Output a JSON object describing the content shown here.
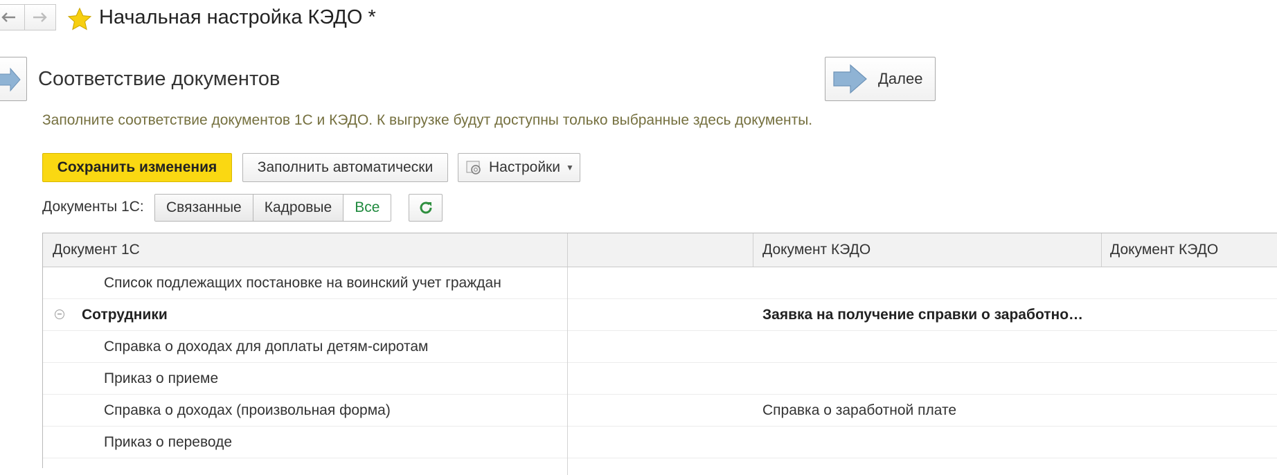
{
  "window": {
    "title": "Начальная настройка КЭДО *",
    "back_icon": "arrow-left-icon",
    "forward_icon": "arrow-right-icon",
    "favorite_icon": "star-icon"
  },
  "header": {
    "title": "Соответствие документов",
    "next_label": "Далее"
  },
  "hint": "Заполните соответствие документов 1С и КЭДО. К выгрузке будут доступны только выбранные здесь документы.",
  "toolbar": {
    "save_label": "Сохранить изменения",
    "autofill_label": "Заполнить автоматически",
    "settings_label": "Настройки"
  },
  "filter": {
    "label": "Документы 1С:",
    "options": [
      "Связанные",
      "Кадровые",
      "Все"
    ],
    "selected": "Все"
  },
  "table": {
    "columns": [
      "Документ 1С",
      "",
      "Документ КЭДО",
      "Документ КЭДО"
    ],
    "rows": [
      {
        "doc1c": "Список подлежащих постановке на воинский учет граждан",
        "kedo": "",
        "group": false
      },
      {
        "doc1c": "Сотрудники",
        "kedo": "Заявка на получение справки о заработно…",
        "group": true
      },
      {
        "doc1c": "Справка о доходах для доплаты детям-сиротам",
        "kedo": "",
        "group": false
      },
      {
        "doc1c": "Приказ о приеме",
        "kedo": "",
        "group": false
      },
      {
        "doc1c": "Справка о доходах (произвольная форма)",
        "kedo": "Справка о заработной плате",
        "group": false
      },
      {
        "doc1c": "Приказ о переводе",
        "kedo": "",
        "group": false
      }
    ]
  },
  "colors": {
    "primary_button": "#fad812",
    "hint_text": "#75703f",
    "active_filter": "#1f8a3e"
  }
}
